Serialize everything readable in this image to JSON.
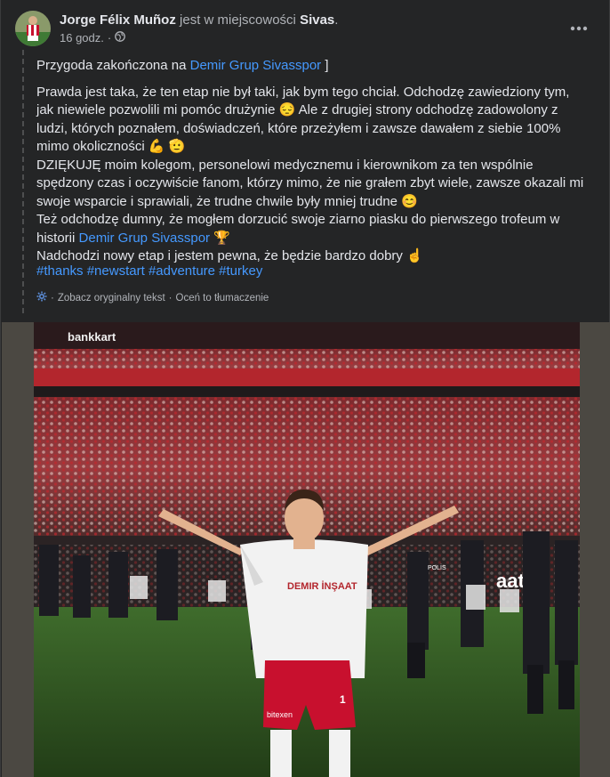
{
  "post": {
    "author_name": "Jorge Félix Muñoz",
    "author_mid": " jest w miejscowości ",
    "author_place": "Sivas",
    "author_end": ".",
    "time": "16 godz.",
    "separator": "·",
    "privacy_icon": "globe-icon",
    "more_icon": "more-dots-icon"
  },
  "body": {
    "line1_prefix": "Przygoda zakończona na ",
    "line1_link": "Demir Grup Sivasspor",
    "line1_suffix": " ]",
    "para1": "Prawda jest taka, że ten etap nie był taki, jak bym tego chciał. Odchodzę zawiedziony tym, jak niewiele pozwolili mi pomóc drużynie",
    "para1_emoji1": "😔",
    "para1_cont": " Ale z drugiej strony odchodzę zadowolony z ludzi, których poznałem, doświadczeń, które przeżyłem i zawsze dawałem z siebie 100% mimo okoliczności ",
    "para1_emoji2": "💪",
    "para1_emoji3": "🫡",
    "para2": "DZIĘKUJĘ moim kolegom, personelowi medycznemu i kierownikom za ten wspólnie spędzony czas i oczywiście fanom, którzy mimo, że nie grałem zbyt wiele, zawsze okazali mi swoje wsparcie i sprawiali, że trudne chwile były mniej trudne ",
    "para2_emoji": "😊",
    "para3_prefix": "Też odchodzę dumny, że mogłem dorzucić swoje ziarno piasku do pierwszego trofeum w historii ",
    "para3_link": "Demir Grup Sivasspor",
    "para3_emoji": "🏆",
    "para4": "Nadchodzi nowy etap i jestem pewna, że będzie bardzo dobry ",
    "para4_emoji": "☝️",
    "hashtags": [
      "#thanks",
      "#newstart",
      "#adventure",
      "#turkey"
    ],
    "translate_icon": "gear-icon",
    "translate_see": "Zobacz oryginalny tekst",
    "translate_sep": " · ",
    "translate_rate": "Oceń to tłumaczenie"
  },
  "photo": {
    "banner_text": "bankkart",
    "shirt_sponsor": "DEMIR İNŞAAT",
    "shorts_sponsor": "bitexen",
    "pitchside_text": "aat",
    "police_text": "POLİS",
    "shirt_number": "1"
  }
}
